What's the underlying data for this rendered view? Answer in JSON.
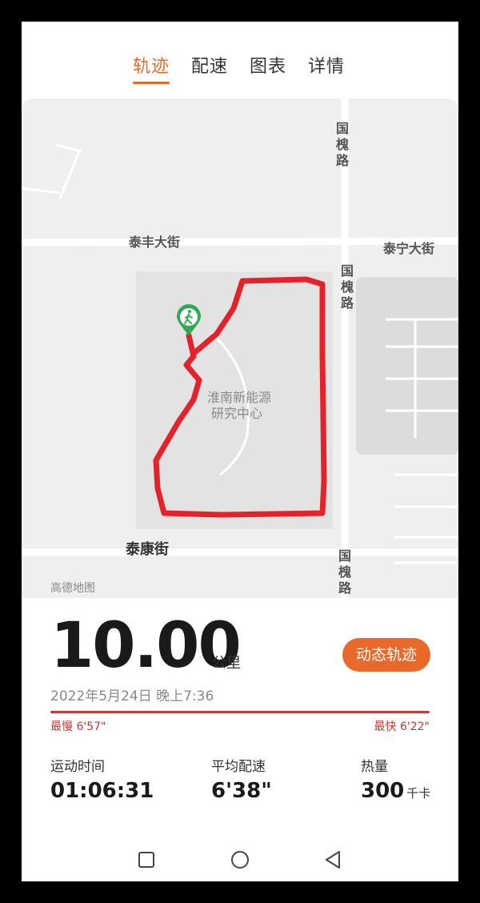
{
  "tabs": [
    {
      "label": "轨迹",
      "active": true
    },
    {
      "label": "配速",
      "active": false
    },
    {
      "label": "图表",
      "active": false
    },
    {
      "label": "详情",
      "active": false
    }
  ],
  "map": {
    "streets": {
      "guohuai_top": "国槐路",
      "guohuai_mid": "国槐路",
      "guohuai_bottom": "国槐路",
      "taifeng": "泰丰大街",
      "taining": "泰宁大街",
      "taikang": "泰康街"
    },
    "poi": [
      "淮南新能源",
      "研究中心"
    ],
    "credit": "高德地图",
    "start_marker_icon": "walking-person-icon",
    "route_color": "#e3232c"
  },
  "summary": {
    "distance": "10.00",
    "distance_unit": "公里",
    "dynamic_track_button": "动态轨迹",
    "datetime": "2022年5月24日 晚上7:36",
    "slowest": "最慢 6'57\"",
    "fastest": "最快 6'22\""
  },
  "stats": {
    "duration": {
      "label": "运动时间",
      "value": "01:06:31"
    },
    "avg_pace": {
      "label": "平均配速",
      "value": "6'38\""
    },
    "calories": {
      "label": "热量",
      "value": "300",
      "unit": "千卡"
    }
  },
  "navbar": {
    "icons": [
      "square-recents-icon",
      "circle-home-icon",
      "triangle-back-icon"
    ]
  },
  "colors": {
    "accent": "#e8692a",
    "pace_bar": "#c53a35"
  }
}
